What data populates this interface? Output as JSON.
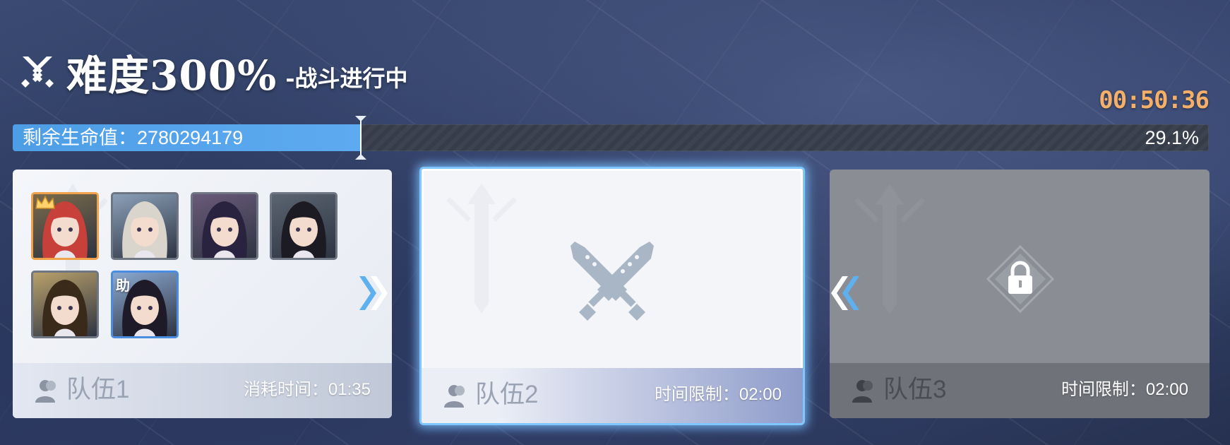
{
  "header": {
    "title": "难度300%",
    "subtitle": "-战斗进行中",
    "timer": "00:50:36"
  },
  "hp": {
    "label": "剩余生命值：2780294179",
    "percent_text": "29.1%",
    "fill_fraction": 0.291
  },
  "teams": [
    {
      "name": "队伍1",
      "time_text": "消耗时间：01:35",
      "status": "completed",
      "members": [
        {
          "role": "leader",
          "hair": "#c8403a",
          "bg": "#7a6a4a"
        },
        {
          "role": "member",
          "hair": "#d9d4cc",
          "bg": "#8aa0b8"
        },
        {
          "role": "member",
          "hair": "#2a2340",
          "bg": "#6a5a7a"
        },
        {
          "role": "member",
          "hair": "#1c1a22",
          "bg": "#5a6470"
        },
        {
          "role": "member",
          "hair": "#3a2a1a",
          "bg": "#b8a06a"
        },
        {
          "role": "support",
          "hair": "#1e1a28",
          "bg": "#8aa8d0",
          "badge": "助"
        }
      ]
    },
    {
      "name": "队伍2",
      "time_text": "时间限制：02:00",
      "status": "active"
    },
    {
      "name": "队伍3",
      "time_text": "时间限制：02:00",
      "status": "locked"
    }
  ],
  "colors": {
    "hp_fill": "#5eaaf0",
    "timer": "#f4b06a",
    "active_border": "#7fc6ff",
    "leader_border": "#f0a24a",
    "support_border": "#4a8de0"
  },
  "icons": [
    "crossed-swords-icon",
    "crown-icon",
    "lock-icon",
    "chevron-right-icon",
    "chevron-left-icon",
    "person-icon"
  ]
}
